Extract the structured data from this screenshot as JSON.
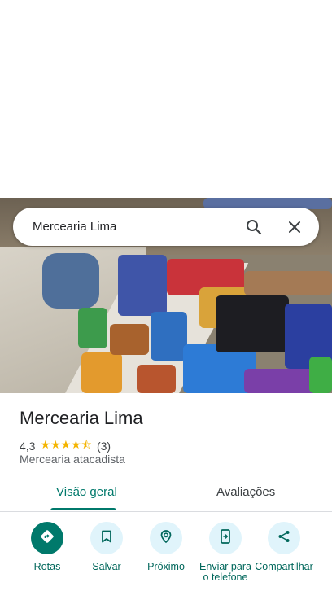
{
  "search": {
    "query": "Mercearia Lima"
  },
  "place": {
    "name": "Mercearia Lima",
    "rating": "4,3",
    "stars": "★★★★⯪",
    "review_count": "(3)",
    "category": "Mercearia atacadista"
  },
  "tabs": [
    {
      "label": "Visão geral",
      "active": true
    },
    {
      "label": "Avaliações",
      "active": false
    }
  ],
  "actions": [
    {
      "label": "Rotas",
      "icon": "directions-icon"
    },
    {
      "label": "Salvar",
      "icon": "bookmark-icon"
    },
    {
      "label": "Próximo",
      "icon": "nearby-icon"
    },
    {
      "label": "Enviar para o telefone",
      "icon": "send-to-phone-icon"
    },
    {
      "label": "Compartilhar",
      "icon": "share-icon"
    }
  ],
  "colors": {
    "accent": "#00796b",
    "action_bg": "#e0f4fb",
    "star": "#f4b400"
  }
}
